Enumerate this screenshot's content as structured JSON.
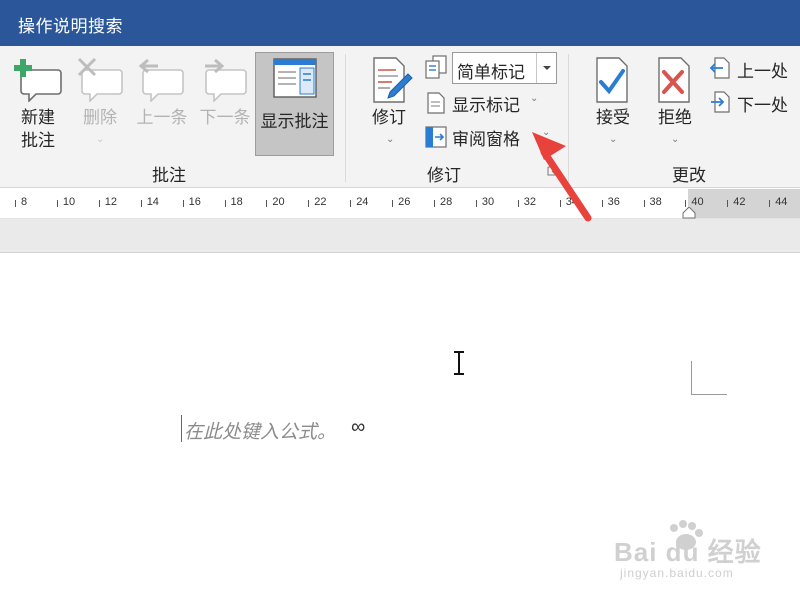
{
  "title_bar": {
    "tell_me": "操作说明搜索",
    "background": "#2b579a"
  },
  "ribbon": {
    "groups": {
      "comments": {
        "label": "批注",
        "new_comment": "新建\n批注",
        "delete": "删除",
        "previous": "上一条",
        "next": "下一条",
        "show_comments": "显示批注"
      },
      "tracking": {
        "label": "修订",
        "track_changes": "修订",
        "display_markup": "简单标记",
        "show_markup": "显示标记",
        "reviewing_pane": "审阅窗格"
      },
      "changes": {
        "label": "更改",
        "accept": "接受",
        "reject": "拒绝",
        "previous_change": "上一处",
        "next_change": "下一处"
      }
    }
  },
  "ruler": {
    "ticks": [
      "8",
      "10",
      "12",
      "14",
      "16",
      "18",
      "20",
      "22",
      "24",
      "26",
      "28",
      "30",
      "32",
      "34",
      "36",
      "38",
      "40",
      "42",
      "44"
    ]
  },
  "document": {
    "equation_placeholder": "在此处键入公式。",
    "paragraph_mark": "∞"
  },
  "watermark": {
    "brand": "Bai du 经验",
    "url": "jingyan.baidu.com"
  },
  "colors": {
    "accent": "#2b579a",
    "annotation_arrow": "#e8423c",
    "accept_check": "#2b7cd3",
    "reject_x": "#d9534f"
  }
}
